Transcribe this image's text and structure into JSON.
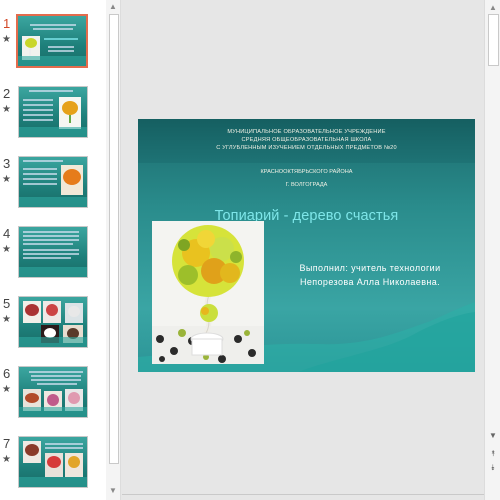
{
  "thumbnails": [
    {
      "number": "1",
      "selected": true
    },
    {
      "number": "2",
      "selected": false
    },
    {
      "number": "3",
      "selected": false
    },
    {
      "number": "4",
      "selected": false
    },
    {
      "number": "5",
      "selected": false
    },
    {
      "number": "6",
      "selected": false
    },
    {
      "number": "7",
      "selected": false
    }
  ],
  "thumb_star": "★",
  "slide": {
    "school_line1": "МУНИЦИПАЛЬНОЕ ОБРАЗОВАТЕЛЬНОЕ УЧРЕЖДЕНИЕ",
    "school_line2": "СРЕДНЯЯ ОБЩЕОБРАЗОВАТЕЛЬНАЯ ШКОЛА",
    "school_line3": "С УГЛУБЛЕННЫМ ИЗУЧЕНИЕМ ОТДЕЛЬНЫХ ПРЕДМЕТОВ №20",
    "district": "КРАСНООКТЯБРЬСКОГО РАЙОНА",
    "city": "Г. ВОЛГОГРАДА",
    "title": "Топиарий - дерево счастья",
    "author_line1": "Выполнил: учитель технологии",
    "author_line2": "Непорезова Алла Николаевна."
  },
  "colors": {
    "accent_selected": "#e36c4d",
    "slide_teal": "#2a8c8c",
    "title_cyan": "#7ee6e9"
  },
  "scrollbar_icons": {
    "up": "▲",
    "down": "▼",
    "prev_slide": "⯭",
    "next_slide": "⯯"
  }
}
